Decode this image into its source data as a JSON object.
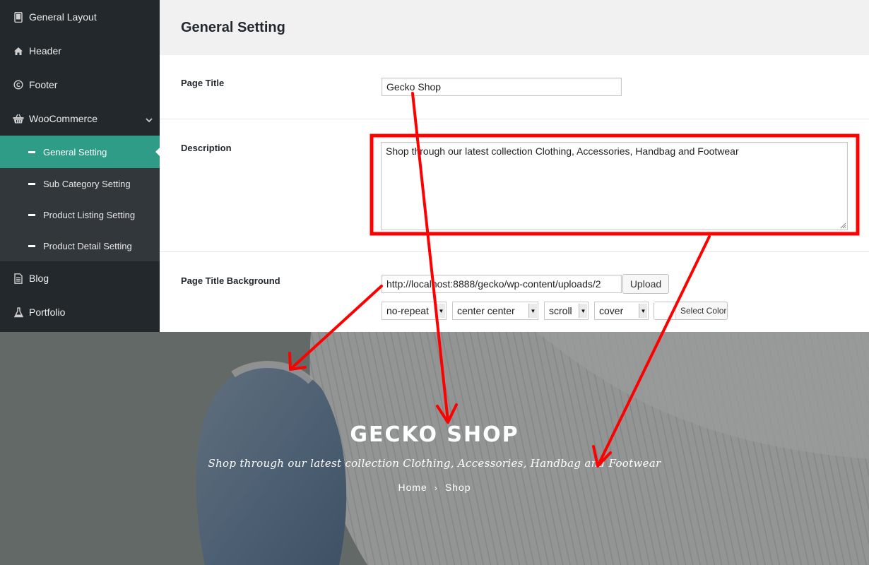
{
  "sidebar": {
    "items": [
      {
        "label": "General Layout",
        "icon": "tablet-icon"
      },
      {
        "label": "Header",
        "icon": "home-icon"
      },
      {
        "label": "Footer",
        "icon": "copyright-icon"
      },
      {
        "label": "WooCommerce",
        "icon": "basket-icon"
      }
    ],
    "submenu": [
      {
        "label": "General Setting",
        "active": true
      },
      {
        "label": "Sub Category Setting"
      },
      {
        "label": "Product Listing Setting"
      },
      {
        "label": "Product Detail Setting"
      }
    ],
    "bottom_items": [
      {
        "label": "Blog",
        "icon": "document-icon"
      },
      {
        "label": "Portfolio",
        "icon": "flask-icon"
      }
    ],
    "active_color": "#2e9c87"
  },
  "main": {
    "title": "General Setting",
    "page_title": {
      "label": "Page Title",
      "value": "Gecko Shop"
    },
    "description": {
      "label": "Description",
      "value": "Shop through our latest collection Clothing, Accessories, Handbag and Footwear"
    },
    "background": {
      "label": "Page Title Background",
      "url": "http://localhost:8888/gecko/wp-content/uploads/2",
      "upload_label": "Upload",
      "repeat": "no-repeat",
      "position": "center center",
      "attachment": "scroll",
      "size": "cover",
      "color_label": "Select Color"
    }
  },
  "preview": {
    "title": "GECKO SHOP",
    "description": "Shop through our latest collection Clothing, Accessories, Handbag and Footwear",
    "breadcrumb": {
      "home": "Home",
      "separator": "›",
      "current": "Shop"
    }
  },
  "annotation_color": "#ff0000"
}
